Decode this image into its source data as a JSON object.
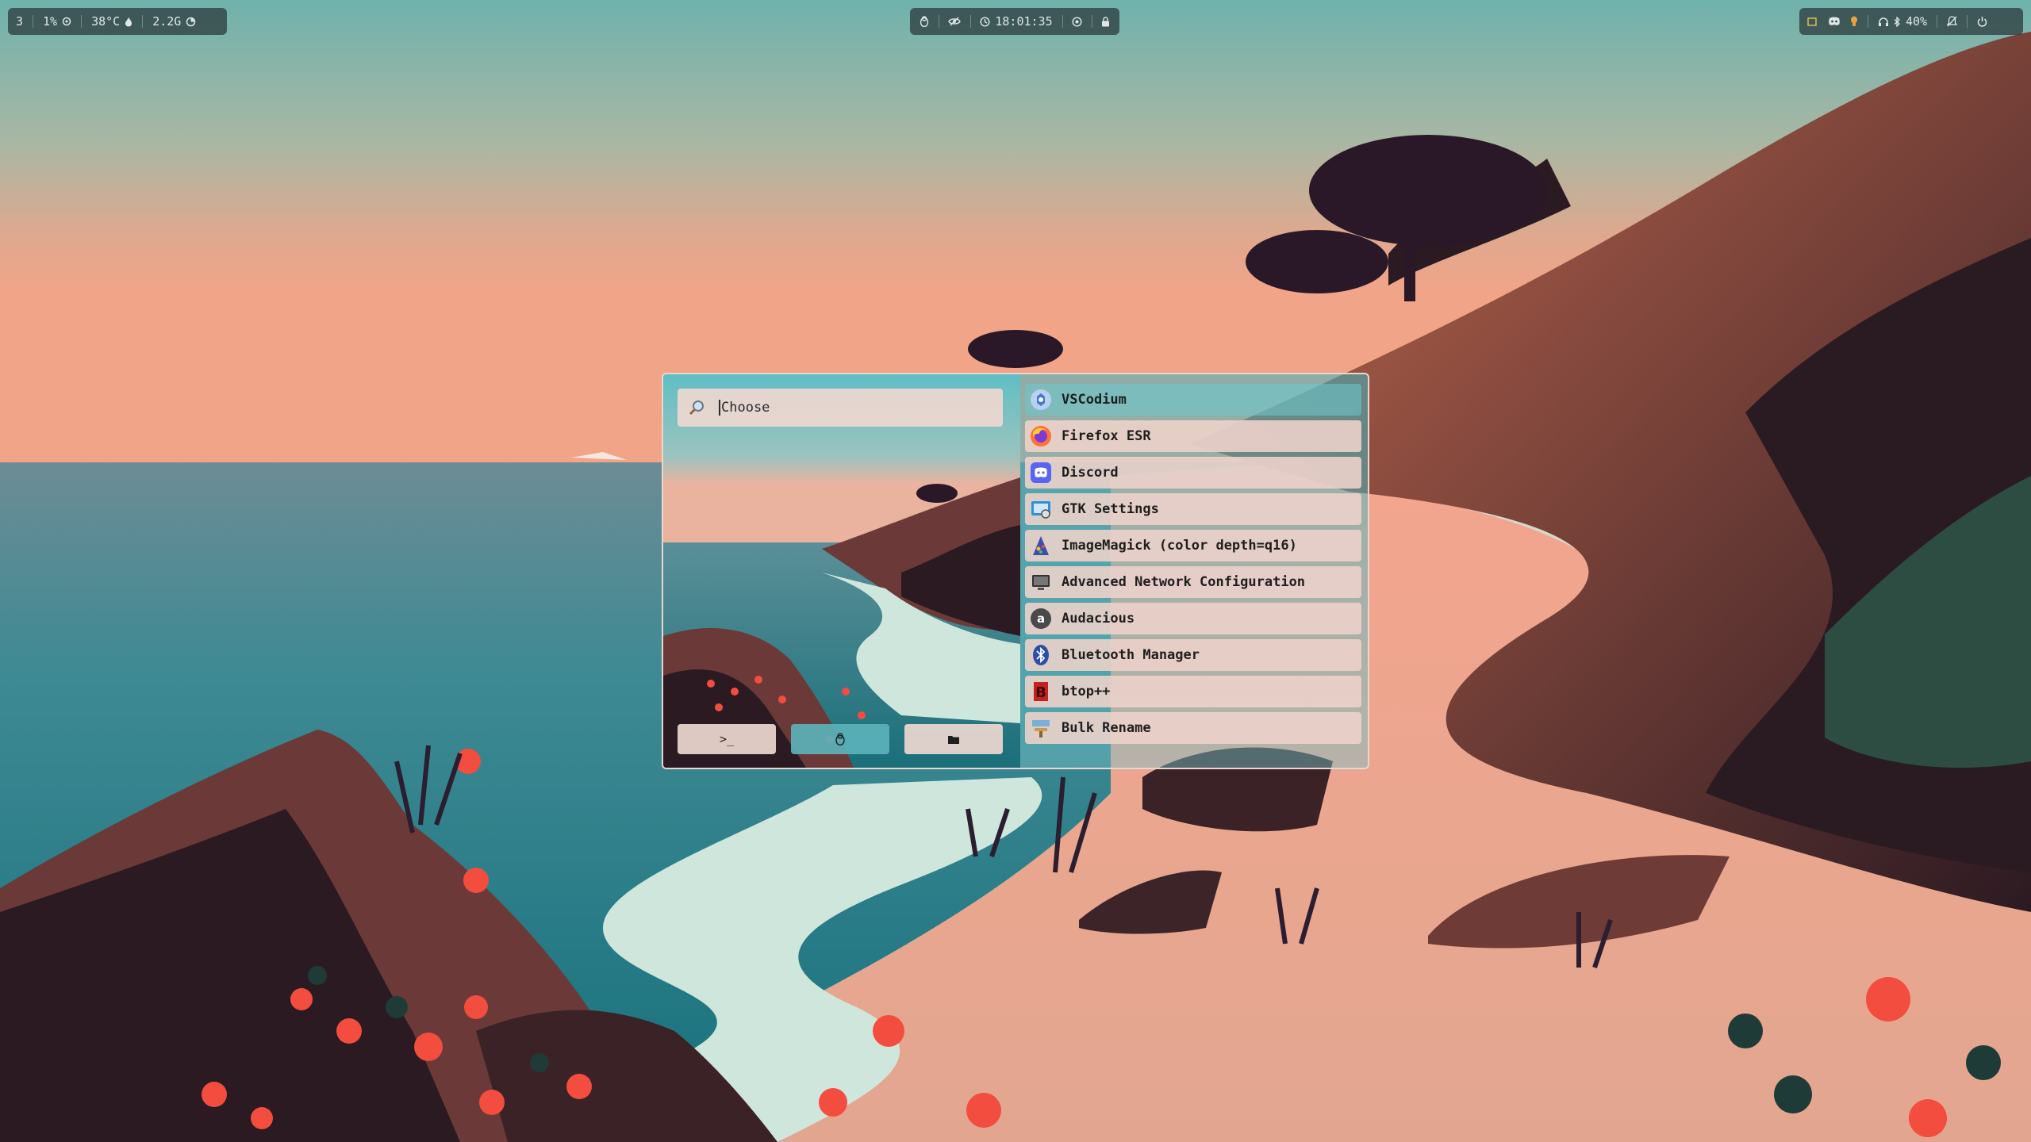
{
  "topbar": {
    "left": {
      "workspace": "3",
      "cpu": "1%",
      "temperature": "38°C",
      "memory": "2.2G"
    },
    "center": {
      "time": "18:01:35"
    },
    "right": {
      "battery": "40%"
    }
  },
  "launcher": {
    "search": {
      "placeholder": "Choose",
      "value": ""
    },
    "modes": [
      {
        "label": ">_",
        "icon": "terminal-icon"
      },
      {
        "label": "",
        "icon": "penguin-icon",
        "active": true
      },
      {
        "label": "",
        "icon": "folder-icon"
      }
    ],
    "apps": [
      {
        "label": "VSCodium",
        "icon": "vscodium-icon",
        "selected": true
      },
      {
        "label": "Firefox ESR",
        "icon": "firefox-icon"
      },
      {
        "label": "Discord",
        "icon": "discord-icon"
      },
      {
        "label": "GTK Settings",
        "icon": "gtk-settings-icon"
      },
      {
        "label": "ImageMagick (color depth=q16)",
        "icon": "imagemagick-icon"
      },
      {
        "label": "Advanced Network Configuration",
        "icon": "network-icon"
      },
      {
        "label": "Audacious",
        "icon": "audacious-icon"
      },
      {
        "label": "Bluetooth Manager",
        "icon": "bluetooth-icon"
      },
      {
        "label": "btop++",
        "icon": "btop-icon"
      },
      {
        "label": "Bulk Rename",
        "icon": "bulk-rename-icon"
      }
    ]
  },
  "colors": {
    "bar_bg": "#283438",
    "launcher_border": "#e9d6cf",
    "row_bg": "#ecd2ca",
    "accent": "#5cb2ba"
  }
}
